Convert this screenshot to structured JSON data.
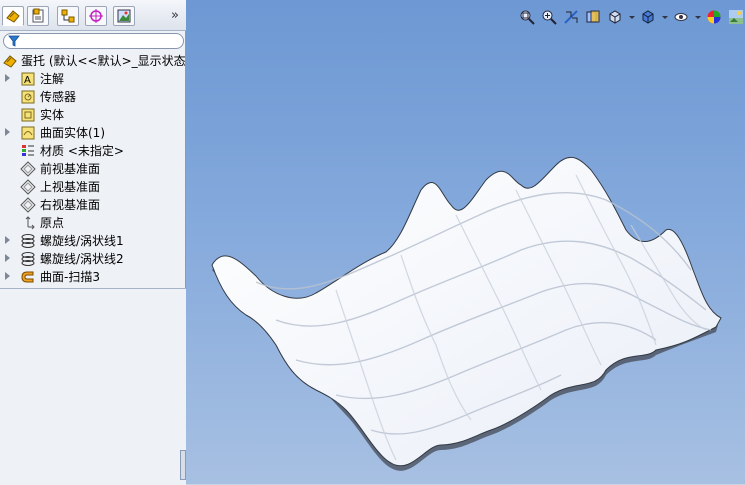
{
  "tree": {
    "root_label": "蛋托 (默认<<默认>_显示状态",
    "items": [
      {
        "label": "注解",
        "icon": "annotation-icon",
        "expandable": true
      },
      {
        "label": "传感器",
        "icon": "sensor-icon",
        "expandable": false
      },
      {
        "label": "实体",
        "icon": "solid-bodies-icon",
        "expandable": false
      },
      {
        "label": "曲面实体(1)",
        "icon": "surface-bodies-icon",
        "expandable": true
      },
      {
        "label": "材质 <未指定>",
        "icon": "material-icon",
        "expandable": false
      },
      {
        "label": "前视基准面",
        "icon": "plane-icon",
        "expandable": false
      },
      {
        "label": "上视基准面",
        "icon": "plane-icon",
        "expandable": false
      },
      {
        "label": "右视基准面",
        "icon": "plane-icon",
        "expandable": false
      },
      {
        "label": "原点",
        "icon": "origin-icon",
        "expandable": false
      },
      {
        "label": "螺旋线/涡状线1",
        "icon": "helix-icon",
        "expandable": true
      },
      {
        "label": "螺旋线/涡状线2",
        "icon": "helix-icon",
        "expandable": true
      },
      {
        "label": "曲面-扫描3",
        "icon": "swept-surface-icon",
        "expandable": true
      }
    ]
  },
  "tabs": [
    "feature-manager-tab",
    "property-manager-tab",
    "configuration-manager-tab",
    "dimxpert-manager-tab",
    "display-manager-tab"
  ],
  "more_tabs_label": "»",
  "colors": {
    "viewport_top": "#6d98d3",
    "viewport_bottom": "#a7c0e2",
    "accent_orange": "#f0a020"
  }
}
